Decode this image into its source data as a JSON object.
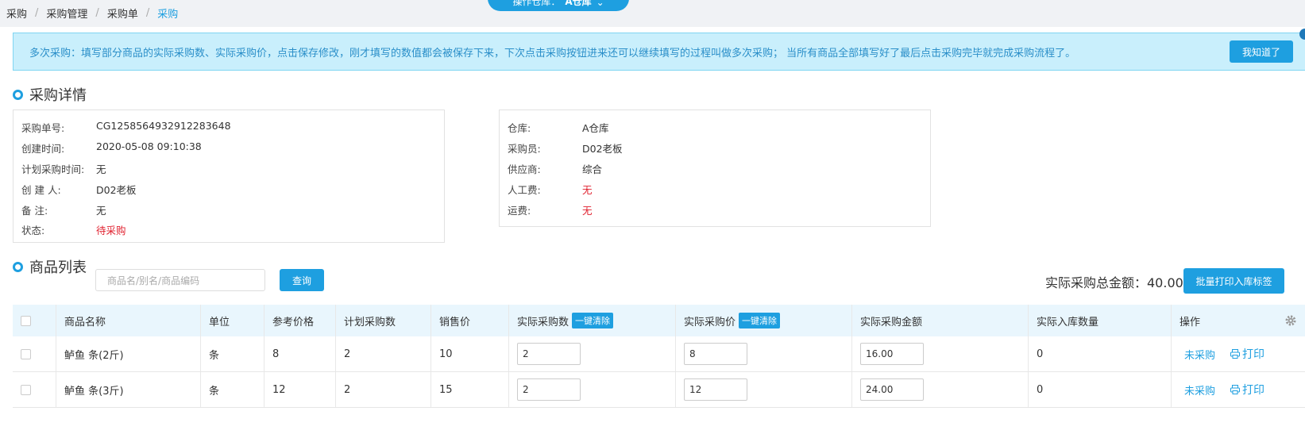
{
  "breadcrumb": [
    "采购",
    "采购管理",
    "采购单",
    "采购"
  ],
  "warehouse_pill": {
    "label": "操作仓库：",
    "value": "A仓库"
  },
  "notice": {
    "text": "多次采购：填写部分商品的实际采购数、实际采购价，点击保存修改，刚才填写的数值都会被保存下来，下次点击采购按钮进来还可以继续填写的过程叫做多次采购； 当所有商品全部填写好了最后点击采购完毕就完成采购流程了。",
    "button": "我知道了"
  },
  "detail": {
    "title": "采购详情",
    "left": [
      {
        "label": "采购单号:",
        "value": "CG1258564932912283648",
        "red": false
      },
      {
        "label": "创建时间:",
        "value": "2020-05-08 09:10:38",
        "red": false
      },
      {
        "label": "计划采购时间:",
        "value": "无",
        "red": false
      },
      {
        "label": "创 建 人:",
        "value": "D02老板",
        "red": false
      },
      {
        "label": "备 注:",
        "value": "无",
        "red": false
      },
      {
        "label": "状态:",
        "value": "待采购",
        "red": true
      }
    ],
    "right": [
      {
        "label": "仓库:",
        "value": "A仓库",
        "red": false
      },
      {
        "label": "采购员:",
        "value": "D02老板",
        "red": false
      },
      {
        "label": "供应商:",
        "value": "综合",
        "red": false
      },
      {
        "label": "人工费:",
        "value": "无",
        "red": true
      },
      {
        "label": "运费:",
        "value": "无",
        "red": true
      }
    ]
  },
  "products": {
    "title": "商品列表",
    "search_placeholder": "商品名/别名/商品编码",
    "query_button": "查询",
    "total_label": "实际采购总金额：40.00",
    "batch_print_button": "批量打印入库标签",
    "clear_tag": "一键清除",
    "columns": [
      "商品名称",
      "单位",
      "参考价格",
      "计划采购数",
      "销售价",
      "实际采购数",
      "实际采购价",
      "实际采购金额",
      "实际入库数量",
      "操作"
    ],
    "rows": [
      {
        "name": "鲈鱼 条(2斤)",
        "unit": "条",
        "ref_price": "8",
        "plan_qty": "2",
        "sale_price": "10",
        "actual_qty": "2",
        "actual_price": "8",
        "amount": "16.00",
        "stock_in": "0",
        "status": "未采购",
        "print": "打印"
      },
      {
        "name": "鲈鱼 条(3斤)",
        "unit": "条",
        "ref_price": "12",
        "plan_qty": "2",
        "sale_price": "15",
        "actual_qty": "2",
        "actual_price": "12",
        "amount": "24.00",
        "stock_in": "0",
        "status": "未采购",
        "print": "打印"
      }
    ]
  },
  "colors": {
    "accent": "#1e9fe0",
    "red": "#e0202e",
    "notice_bg": "#c9effc"
  }
}
